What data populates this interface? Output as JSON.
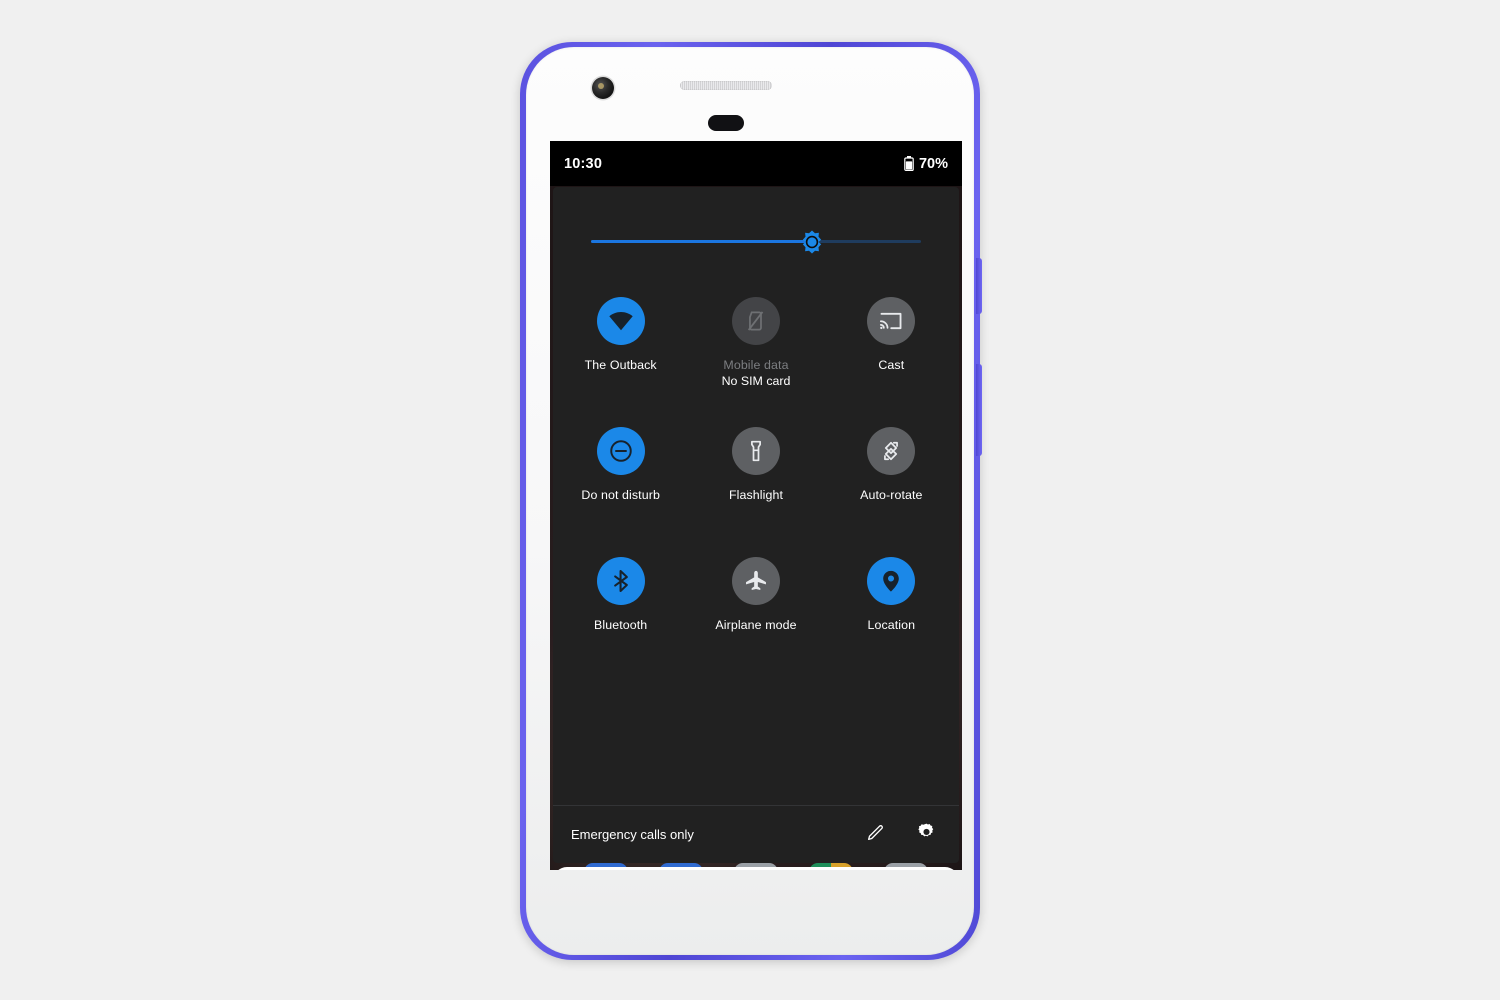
{
  "device": {
    "name": "pixel-phone",
    "frame_color": "#5b52e0",
    "body_color": "#fbfbfc"
  },
  "status_bar": {
    "time": "10:30",
    "battery_percent": "70%",
    "battery_icon": "battery-icon",
    "background": "#000000"
  },
  "quick_settings": {
    "brightness": {
      "name": "brightness-slider",
      "value_percent": 67,
      "thumb_icon": "brightness-sun-icon",
      "fill_color": "#1b76e8",
      "track_color": "#1f3c5e"
    },
    "tiles": [
      [
        {
          "id": "wifi",
          "label": "The Outback",
          "sublabel": "",
          "state": "on",
          "icon": "wifi-icon",
          "color": "#1b88e8"
        },
        {
          "id": "mobile-data",
          "label": "Mobile data",
          "sublabel": "No SIM card",
          "state": "disabled",
          "icon": "no-sim-icon",
          "color": "#434447"
        },
        {
          "id": "cast",
          "label": "Cast",
          "sublabel": "",
          "state": "off",
          "icon": "cast-icon",
          "color": "#5e6063"
        }
      ],
      [
        {
          "id": "do-not-disturb",
          "label": "Do not disturb",
          "sublabel": "",
          "state": "on",
          "icon": "do-not-disturb-icon",
          "color": "#1b88e8"
        },
        {
          "id": "flashlight",
          "label": "Flashlight",
          "sublabel": "",
          "state": "off",
          "icon": "flashlight-icon",
          "color": "#5e6063"
        },
        {
          "id": "auto-rotate",
          "label": "Auto-rotate",
          "sublabel": "",
          "state": "off",
          "icon": "auto-rotate-icon",
          "color": "#5e6063"
        }
      ],
      [
        {
          "id": "bluetooth",
          "label": "Bluetooth",
          "sublabel": "",
          "state": "on",
          "icon": "bluetooth-icon",
          "color": "#1b88e8"
        },
        {
          "id": "airplane-mode",
          "label": "Airplane mode",
          "sublabel": "",
          "state": "off",
          "icon": "airplane-icon",
          "color": "#5e6063"
        },
        {
          "id": "location",
          "label": "Location",
          "sublabel": "",
          "state": "on",
          "icon": "location-pin-icon",
          "color": "#1b88e8"
        }
      ]
    ],
    "footer": {
      "carrier_status": "Emergency calls only",
      "edit_icon": "pencil-edit-icon",
      "settings_icon": "gear-settings-icon"
    },
    "panel_background": "#212121"
  },
  "notification_card": {
    "name": "notification-card",
    "app_icon": "pinwheel-icon",
    "separator": "dot",
    "title": "",
    "background": "#ffffff"
  },
  "home_screen": {
    "search_bar": {
      "name": "google-search-bar",
      "logo": "google-g-icon",
      "text": ""
    },
    "dock_icon_colors": [
      "#2f6ad0",
      "#2f6ad0",
      "#9aa0a6",
      "#1e8e5a",
      "#d6a02a",
      "#9aa0a6"
    ]
  },
  "nav_bar": {
    "back_icon": "back-chevron-icon",
    "home_indicator": "home-pill-indicator"
  }
}
